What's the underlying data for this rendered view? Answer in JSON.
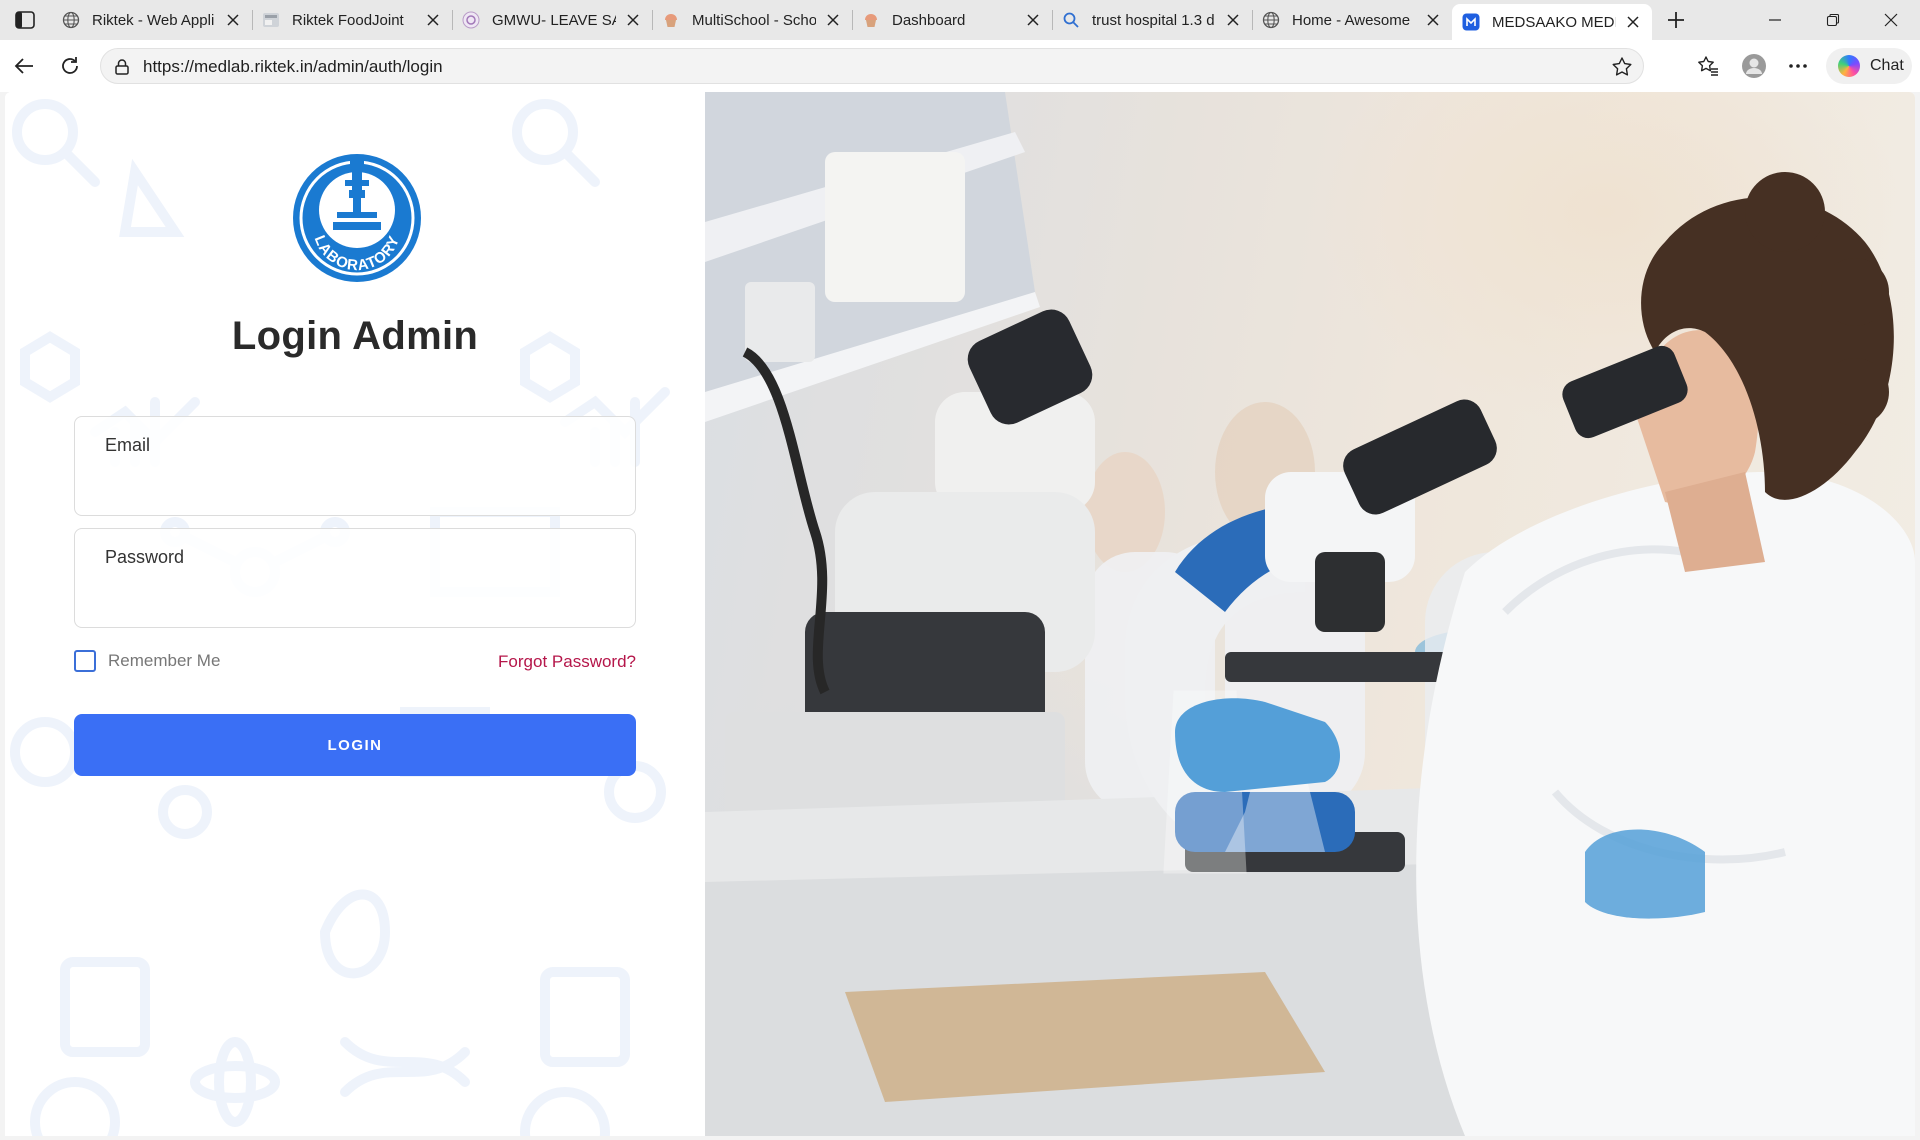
{
  "browser": {
    "tabs": [
      {
        "title": "Riktek - Web Appli",
        "favicon": "globe-icon",
        "active": false,
        "width": 200
      },
      {
        "title": "Riktek FoodJoint",
        "favicon": "page-thumbnail-icon",
        "active": false,
        "width": 200
      },
      {
        "title": "GMWU- LEAVE SA",
        "favicon": "logo-icon",
        "active": false,
        "width": 200
      },
      {
        "title": "MultiSchool - Scho",
        "favicon": "cupcake-icon",
        "active": false,
        "width": 200
      },
      {
        "title": "Dashboard",
        "favicon": "cupcake-icon",
        "active": false,
        "width": 200
      },
      {
        "title": "trust hospital 1.3 d",
        "favicon": "search-icon",
        "active": false,
        "width": 200
      },
      {
        "title": "Home - Awesome",
        "favicon": "globe-icon",
        "active": false,
        "width": 200
      },
      {
        "title": "MEDSAAKO MEDIC",
        "favicon": "app-logo-icon",
        "active": true,
        "width": 200
      }
    ],
    "url": "https://medlab.riktek.in/admin/auth/login",
    "chat_label": "Chat"
  },
  "login": {
    "logo_text": "LABORATORY",
    "title": "Login Admin",
    "email_label": "Email",
    "email_value": "",
    "password_label": "Password",
    "password_value": "",
    "remember_label": "Remember Me",
    "forgot_label": "Forgot Password?",
    "submit_label": "LOGIN"
  },
  "colors": {
    "primary": "#3a6ff5",
    "forgot_link": "#b5164a",
    "logo_blue": "#1a7ad1",
    "checkbox": "#3b6fd8"
  }
}
